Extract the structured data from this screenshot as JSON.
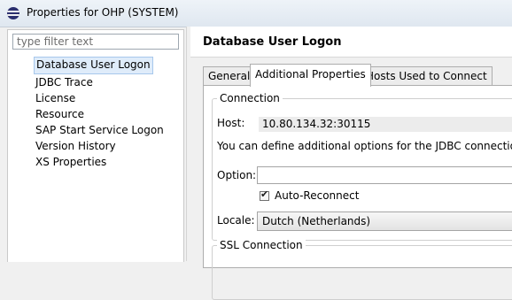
{
  "window": {
    "title": "Properties for OHP (SYSTEM)"
  },
  "nav": {
    "filter_placeholder": "type filter text",
    "items": [
      {
        "label": "Database User Logon",
        "selected": true
      },
      {
        "label": "JDBC Trace"
      },
      {
        "label": "License"
      },
      {
        "label": "Resource"
      },
      {
        "label": "SAP Start Service Logon"
      },
      {
        "label": "Version History"
      },
      {
        "label": "XS Properties"
      }
    ]
  },
  "page": {
    "title": "Database User Logon",
    "tabs": [
      {
        "label": "General"
      },
      {
        "label": "Additional Properties",
        "active": true
      },
      {
        "label": "Hosts Used to Connect"
      }
    ],
    "connection": {
      "legend": "Connection",
      "host_label": "Host:",
      "host_value": "10.80.134.32:30115",
      "info_text": "You can define additional options for the JDBC connection.",
      "option_label": "Option:",
      "option_value": "",
      "auto_reconnect_label": "Auto-Reconnect",
      "auto_reconnect_checked": true,
      "locale_label": "Locale:",
      "locale_value": "Dutch (Netherlands)"
    },
    "ssl": {
      "legend": "SSL Connection"
    }
  },
  "colors": {
    "selection_bg": "#dfecfa",
    "selection_border": "#a7c8ec",
    "eclipse_icon": "#2b2f6e"
  },
  "icons": {
    "app": "eclipse-icon"
  }
}
